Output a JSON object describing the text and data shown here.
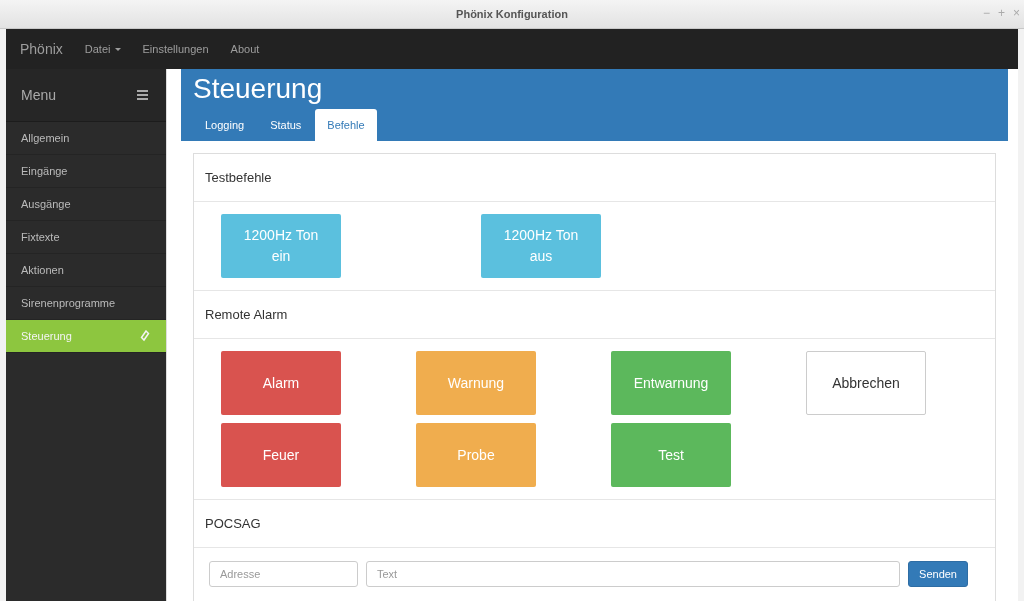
{
  "window": {
    "title": "Phönix Konfiguration",
    "controls": [
      "−",
      "+",
      "×"
    ]
  },
  "navbar": {
    "brand": "Phönix",
    "items": [
      {
        "label": "Datei",
        "dropdown": true
      },
      {
        "label": "Einstellungen",
        "dropdown": false
      },
      {
        "label": "About",
        "dropdown": false
      }
    ]
  },
  "sidebar": {
    "title": "Menu",
    "items": [
      {
        "label": "Allgemein",
        "selected": false
      },
      {
        "label": "Eingänge",
        "selected": false
      },
      {
        "label": "Ausgänge",
        "selected": false
      },
      {
        "label": "Fixtexte",
        "selected": false
      },
      {
        "label": "Aktionen",
        "selected": false
      },
      {
        "label": "Sirenenprogramme",
        "selected": false
      },
      {
        "label": "Steuerung",
        "selected": true
      }
    ]
  },
  "page": {
    "title": "Steuerung",
    "tabs": [
      {
        "label": "Logging",
        "selected": false
      },
      {
        "label": "Status",
        "selected": false
      },
      {
        "label": "Befehle",
        "selected": true
      }
    ]
  },
  "sections": [
    {
      "title": "Testbefehle",
      "kind": "wide",
      "buttons": [
        {
          "label": "1200Hz Ton ein",
          "kind": "info"
        },
        {
          "label": "1200Hz Ton aus",
          "kind": "info"
        }
      ]
    },
    {
      "title": "Remote Alarm",
      "kind": "grid",
      "buttons": [
        {
          "label": "Alarm",
          "kind": "danger"
        },
        {
          "label": "Warnung",
          "kind": "warning"
        },
        {
          "label": "Entwarnung",
          "kind": "success"
        },
        {
          "label": "Abbrechen",
          "kind": "default"
        },
        {
          "label": "Feuer",
          "kind": "danger"
        },
        {
          "label": "Probe",
          "kind": "warning"
        },
        {
          "label": "Test",
          "kind": "success"
        }
      ]
    },
    {
      "title": "POCSAG",
      "form": {
        "address": {
          "placeholder": "Adresse"
        },
        "text": {
          "placeholder": "Text"
        },
        "submit": "Senden"
      }
    }
  ]
}
